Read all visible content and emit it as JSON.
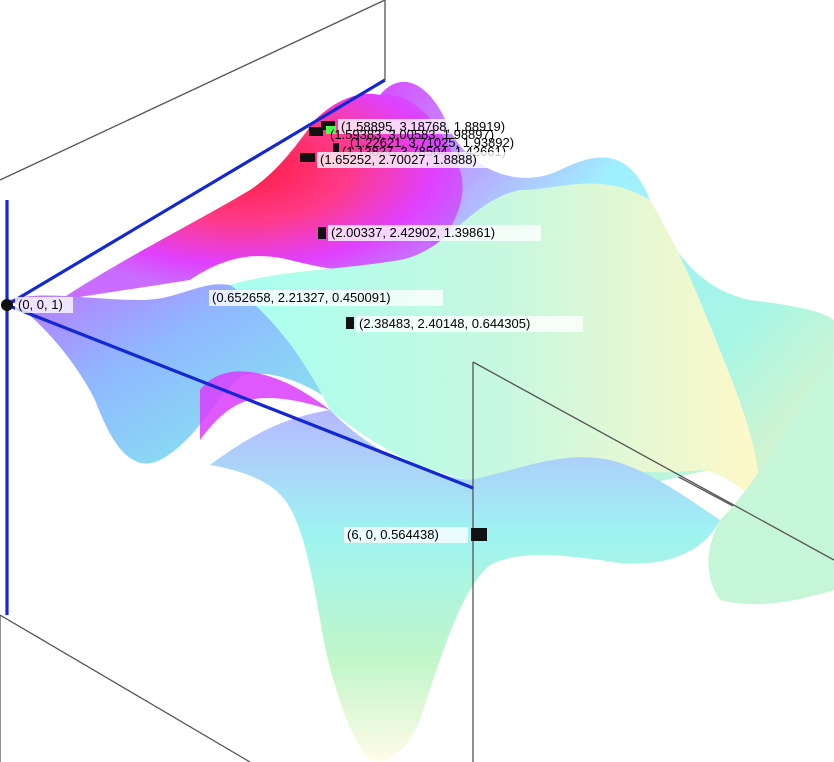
{
  "scene": {
    "surface_colors": {
      "peak": "#ff1a3c",
      "magenta": "#e040ff",
      "violet": "#c060ff",
      "cyan": "#80ffe8",
      "aqua": "#a0f4f0",
      "yellow": "#fff4b0",
      "pale": "#fffde0"
    },
    "box_edge_color": "#555555",
    "highlight_edge_color": "#1428d2"
  },
  "points": [
    {
      "id": "p1",
      "label": "(1.58895, 3.18768, 1.88919)",
      "marker": "square"
    },
    {
      "id": "p2",
      "label": "(1.59383, 3.00583, 1.98897)",
      "marker": "square"
    },
    {
      "id": "p3",
      "label": "(1.22621, 3.71025, 1.93892)",
      "marker": "square"
    },
    {
      "id": "p4",
      "label": "(1.13827, 3.78504, 1.42661)",
      "marker": "square"
    },
    {
      "id": "p5",
      "label": "(1.65252, 2.70027, 1.8888)",
      "marker": "square"
    },
    {
      "id": "p6",
      "label": "(2.00337, 2.42902, 1.39861)",
      "marker": "square"
    },
    {
      "id": "p7",
      "label": "(0.652658, 2.21327, 0.450091)",
      "marker": "none"
    },
    {
      "id": "p8",
      "label": "(2.38483, 2.40148, 0.644305)",
      "marker": "square"
    },
    {
      "id": "p9",
      "label": "(0, 0, 1)",
      "marker": "circle"
    },
    {
      "id": "p10",
      "label": "(6, 0, 0.564438)",
      "marker": "square"
    }
  ]
}
